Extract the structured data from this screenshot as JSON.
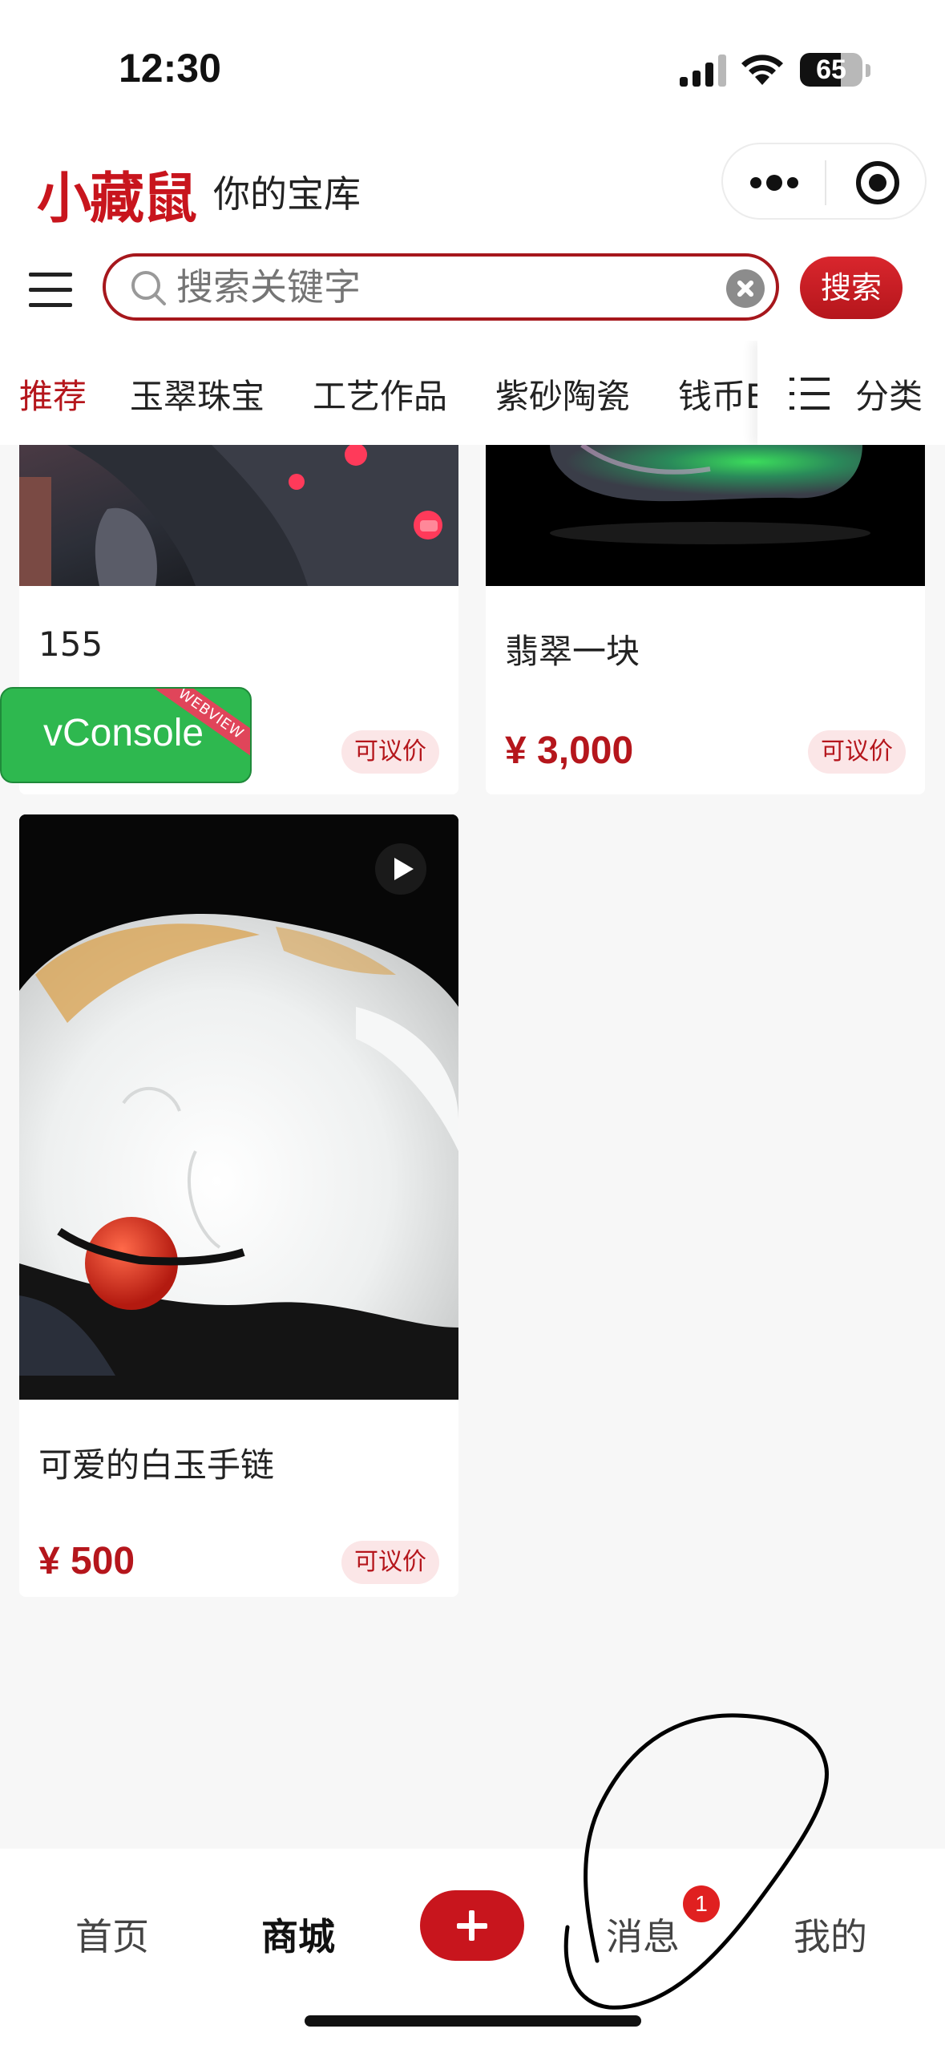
{
  "status_bar": {
    "time": "12:30",
    "battery": "65",
    "battery_level": 0.65
  },
  "header": {
    "logo": "小藏鼠",
    "slogan": "你的宝库"
  },
  "search": {
    "placeholder": "搜索关键字",
    "button": "搜索"
  },
  "category_tabs": {
    "items": [
      "推荐",
      "玉翠珠宝",
      "工艺作品",
      "紫砂陶瓷",
      "钱币E"
    ],
    "active_index": 0,
    "category_button": "分类"
  },
  "products": [
    {
      "title": "155",
      "price": "",
      "negotiable": "可议价",
      "image": "robot-image"
    },
    {
      "title": "翡翠一块",
      "price": "¥ 3,000",
      "negotiable": "可议价",
      "image": "jade-image"
    },
    {
      "title": "可爱的白玉手链",
      "price": "¥ 500",
      "negotiable": "可议价",
      "image": "white-jade-image",
      "is_video": true
    }
  ],
  "vconsole": {
    "label": "vConsole",
    "ribbon": "WEBVIEW"
  },
  "tabbar": {
    "items": [
      "首页",
      "商城",
      "消息",
      "我的"
    ],
    "active": "商城",
    "message_badge": "1"
  },
  "colors": {
    "brand": "#b5161c",
    "badge": "#e02020",
    "vconsole": "#2eb84f"
  }
}
